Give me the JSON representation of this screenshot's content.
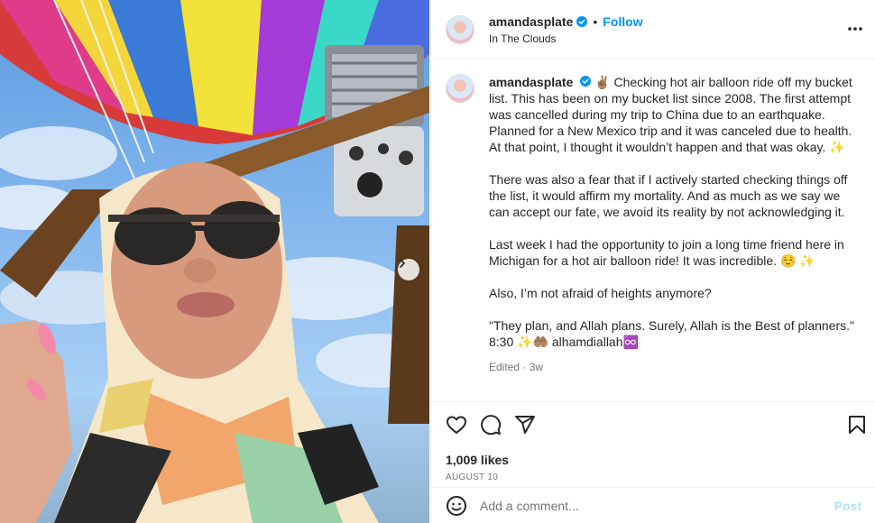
{
  "post": {
    "username": "amandasplate",
    "follow_label": "Follow",
    "location": "In The Clouds",
    "caption_lead": "✌🏽 Checking hot air balloon ride off my bucket list. This has been on my bucket list since 2008. The first attempt was cancelled during my trip to China due to an earthquake. Planned for a New Mexico trip and it was canceled due to health. At that point, I thought it wouldn’t happen and that was okay. ✨",
    "caption_p2": "There was also a fear that if I actively started checking things off the list, it would affirm my mortality. And as much as we say we can accept our fate, we avoid its reality by not acknowledging it.",
    "caption_p3": "Last week I had the opportunity to join a long time friend here in Michigan for a hot air balloon ride! It was incredible. ☺️ ✨",
    "caption_p4": "Also, I’m not afraid of heights anymore?",
    "caption_p5": "\"They plan, and Allah plans. Surely, Allah is the Best of planners.\" 8:30 ✨🤲🏽 alhamdiallah♾️",
    "edited": "Edited · 3w",
    "likes": "1,009 likes",
    "date": "AUGUST 10"
  },
  "comment": {
    "placeholder": "Add a comment...",
    "post_label": "Post"
  },
  "icons": {
    "verified": "verified-badge-icon",
    "more": "more-options-icon",
    "like": "heart-icon",
    "comment": "comment-bubble-icon",
    "share": "paper-plane-icon",
    "save": "bookmark-icon",
    "emoji": "smiley-icon",
    "next": "chevron-right-icon"
  },
  "colors": {
    "accent": "#0095f6",
    "verified": "#0095f6",
    "muted": "#737373"
  }
}
